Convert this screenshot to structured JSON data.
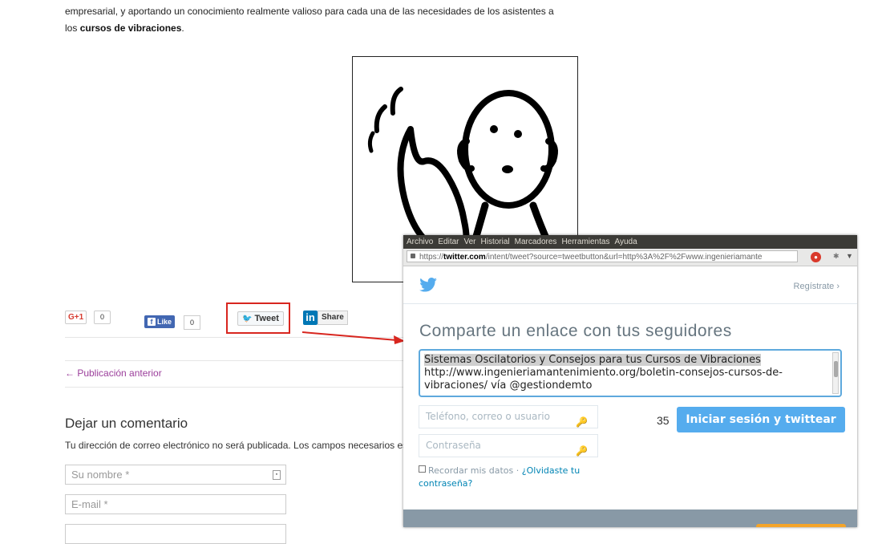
{
  "article": {
    "intro_line1": "empresarial, y aportando un conocimiento realmente valioso para cada una de las necesidades de los asistentes a",
    "intro_line2_pre": "los ",
    "intro_line2_bold": "cursos de vibraciones",
    "intro_line2_post": "."
  },
  "share": {
    "gplus_label": "G+1",
    "gplus_count": "0",
    "fb_label": "Like",
    "fb_count": "0",
    "tweet_label": "Tweet",
    "linkedin_logo": "in",
    "linkedin_label": "Share"
  },
  "nav": {
    "prev_post": "← Publicación anterior"
  },
  "comment_form": {
    "title": "Dejar un comentario",
    "note": "Tu dirección de correo electrónico no será publicada. Los campos necesarios están marcados",
    "name_placeholder": "Su nombre *",
    "email_placeholder": "E-mail *"
  },
  "browser": {
    "menu": [
      "Archivo",
      "Editar",
      "Ver",
      "Historial",
      "Marcadores",
      "Herramientas",
      "Ayuda"
    ],
    "url_prefix": "https://",
    "url_domain": "twitter.com",
    "url_rest": "/intent/tweet?source=tweetbutton&url=http%3A%2F%2Fwww.ingenieriamante"
  },
  "twitter": {
    "signup": "Regístrate ›",
    "title": "Comparte un enlace con tus seguidores",
    "tweet_selected": "Sistemas Oscilatorios y Consejos para tus Cursos de Vibraciones",
    "tweet_rest": "http://www.ingenieriamantenimiento.org/boletin-consejos-cursos-de-vibraciones/ vía @gestiondemto",
    "username_placeholder": "Teléfono, correo o usuario",
    "password_placeholder": "Contraseña",
    "char_count": "35",
    "login_button": "Iniciar sesión y twittear",
    "remember": "Recordar mis datos",
    "separator": " · ",
    "forgot": "¿Olvidaste tu contraseña?"
  },
  "colors": {
    "twitter_blue": "#55acee",
    "highlight_red": "#d8261f",
    "link_purple": "#9b3e9b"
  }
}
